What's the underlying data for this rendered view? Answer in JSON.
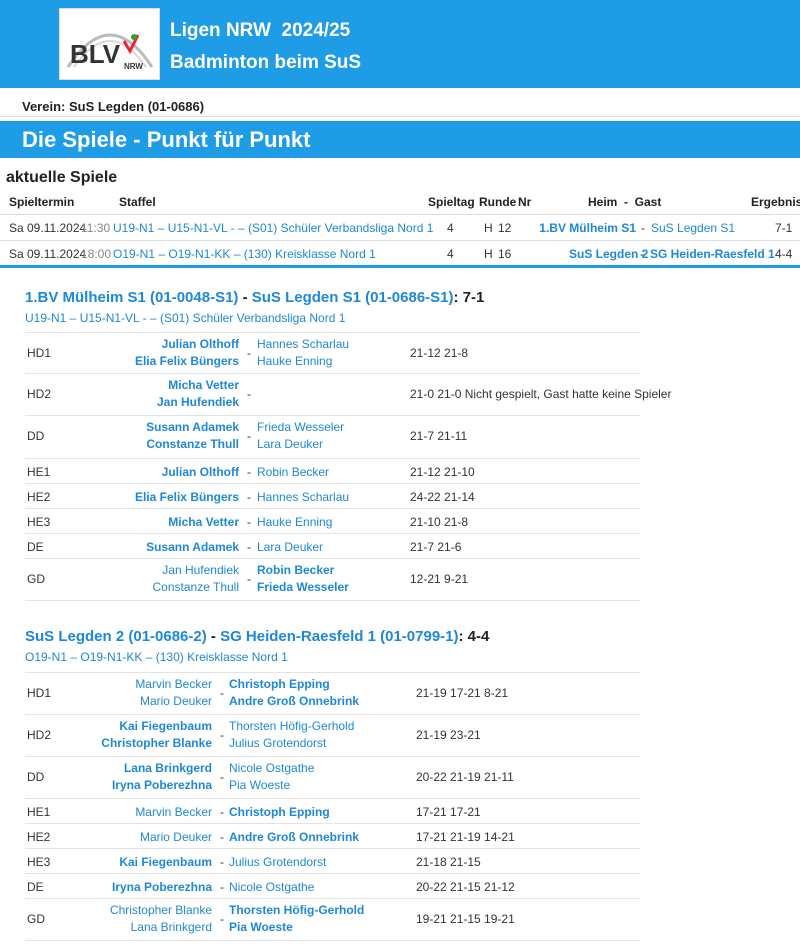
{
  "header": {
    "logo_text": "BLV NRW",
    "title": "Ligen NRW  2024/25",
    "subtitle": "Badminton beim SuS"
  },
  "verein": "Verein: SuS Legden (01-0686)",
  "banner": "Die Spiele - Punkt für Punkt",
  "aktuelle": {
    "title": "aktuelle Spiele",
    "headers": {
      "spieltermin": "Spieltermin",
      "staffel": "Staffel",
      "spieltag": "Spieltag",
      "runde": "Runde",
      "nr": "Nr",
      "heimgast": "Heim  -  Gast",
      "ergebnis": "Ergebnis"
    },
    "rows": [
      {
        "date": "Sa 09.11.2024",
        "time": "11:30",
        "staffel": "U19-N1 – U15-N1-VL - – (S01) Schüler Verbandsliga Nord 1",
        "spieltag": "4",
        "runde": "H",
        "nr": "12",
        "heim": "1.BV Mülheim S1",
        "sep": "-",
        "gast": "SuS Legden S1",
        "ergebnis": "7-1"
      },
      {
        "date": "Sa 09.11.2024",
        "time": "18:00",
        "staffel": "O19-N1 – O19-N1-KK – (130) Kreisklasse Nord 1",
        "spieltag": "4",
        "runde": "H",
        "nr": "16",
        "heim": "SuS Legden 2",
        "sep": "-",
        "gast": "SG Heiden-Raesfeld 1",
        "ergebnis": "4-4"
      }
    ]
  },
  "matches": [
    {
      "home": "1.BV Mülheim S1 (01-0048-S1)",
      "dash": " - ",
      "away": "SuS Legden S1 (01-0686-S1)",
      "score": ": 7-1",
      "staffel": "U19-N1 – U15-N1-VL - – (S01) Schüler Verbandsliga Nord 1",
      "games": [
        {
          "disc": "HD1",
          "home": [
            "Julian Olthoff",
            "Elia Felix Büngers"
          ],
          "away": [
            "Hannes Scharlau",
            "Hauke Enning"
          ],
          "result": "21-12 21-8"
        },
        {
          "disc": "HD2",
          "home": [
            "Micha Vetter",
            "Jan Hufendiek"
          ],
          "away": [],
          "result": "21-0 21-0 Nicht gespielt, Gast hatte keine Spieler"
        },
        {
          "disc": "DD",
          "home": [
            "Susann Adamek",
            "Constanze Thull"
          ],
          "away": [
            "Frieda Wesseler",
            "Lara Deuker"
          ],
          "result": "21-7 21-11"
        },
        {
          "disc": "HE1",
          "home": [
            "Julian Olthoff"
          ],
          "away": [
            "Robin Becker"
          ],
          "result": "21-12 21-10"
        },
        {
          "disc": "HE2",
          "home": [
            "Elia Felix Büngers"
          ],
          "away": [
            "Hannes Scharlau"
          ],
          "result": "24-22 21-14"
        },
        {
          "disc": "HE3",
          "home": [
            "Micha Vetter"
          ],
          "away": [
            "Hauke Enning"
          ],
          "result": "21-10 21-8"
        },
        {
          "disc": "DE",
          "home": [
            "Susann Adamek"
          ],
          "away": [
            "Lara Deuker"
          ],
          "result": "21-7 21-6"
        },
        {
          "disc": "GD",
          "home": [
            "Jan Hufendiek",
            "Constanze Thull"
          ],
          "away": [
            "Robin Becker",
            "Frieda Wesseler"
          ],
          "result": "12-21 9-21"
        }
      ]
    },
    {
      "home": "SuS Legden 2 (01-0686-2)",
      "dash": " - ",
      "away": "SG Heiden-Raesfeld 1 (01-0799-1)",
      "score": ": 4-4",
      "staffel": "O19-N1 – O19-N1-KK – (130) Kreisklasse Nord 1",
      "games": [
        {
          "disc": "HD1",
          "home": [
            "Marvin Becker",
            "Mario Deuker"
          ],
          "away": [
            "Christoph Epping",
            "Andre Groß Onnebrink"
          ],
          "result": "21-19 17-21 8-21"
        },
        {
          "disc": "HD2",
          "home": [
            "Kai Fiegenbaum",
            "Christopher Blanke"
          ],
          "away": [
            "Thorsten Höfig-Gerhold",
            "Julius Grotendorst"
          ],
          "result": "21-19 23-21"
        },
        {
          "disc": "DD",
          "home": [
            "Lana Brinkgerd",
            "Iryna Poberezhna"
          ],
          "away": [
            "Nicole Ostgathe",
            "Pia Woeste"
          ],
          "result": "20-22 21-19 21-11"
        },
        {
          "disc": "HE1",
          "home": [
            "Marvin Becker"
          ],
          "away": [
            "Christoph Epping"
          ],
          "result": "17-21 17-21"
        },
        {
          "disc": "HE2",
          "home": [
            "Mario Deuker"
          ],
          "away": [
            "Andre Groß Onnebrink"
          ],
          "result": "17-21 21-19 14-21"
        },
        {
          "disc": "HE3",
          "home": [
            "Kai Fiegenbaum"
          ],
          "away": [
            "Julius Grotendorst"
          ],
          "result": "21-18 21-15"
        },
        {
          "disc": "DE",
          "home": [
            "Iryna Poberezhna"
          ],
          "away": [
            "Nicole Ostgathe"
          ],
          "result": "20-22 21-15 21-12"
        },
        {
          "disc": "GD",
          "home": [
            "Christopher Blanke",
            "Lana Brinkgerd"
          ],
          "away": [
            "Thorsten Höfig-Gerhold",
            "Pia Woeste"
          ],
          "result": "19-21 21-15 19-21"
        }
      ]
    }
  ],
  "colors": {
    "accent": "#1e9ce6",
    "link": "#1e88d8"
  }
}
